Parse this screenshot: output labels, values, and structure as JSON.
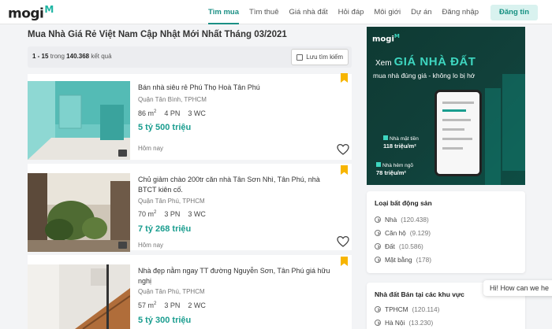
{
  "header": {
    "logo_text": "mogi",
    "logo_mark": "M",
    "nav": [
      {
        "label": "Tìm mua",
        "active": true
      },
      {
        "label": "Tìm thuê",
        "active": false
      },
      {
        "label": "Giá nhà đất",
        "active": false
      },
      {
        "label": "Hỏi đáp",
        "active": false
      },
      {
        "label": "Môi giới",
        "active": false
      },
      {
        "label": "Dự án",
        "active": false
      },
      {
        "label": "Đăng nhập",
        "active": false
      }
    ],
    "signup_label": "Đăng tin"
  },
  "main": {
    "title": "Mua Nhà Giá Rẻ Việt Nam Cập Nhật Mới Nhất Tháng 03/2021",
    "results": {
      "range": "1 - 15",
      "in_word": "trong",
      "total": "140.368",
      "suffix": "kết quả"
    },
    "save_search_label": "Lưu tìm kiếm",
    "listings": [
      {
        "title": "Bán nhà siêu rẻ Phú Thọ Hoà Tân Phú",
        "location": "Quận Tân Bình, TPHCM",
        "area": "86 m",
        "area_unit": "2",
        "bedrooms": "4 PN",
        "baths": "3 WC",
        "price": "5 tỷ 500 triệu",
        "date": "Hôm nay"
      },
      {
        "title": "Chủ giảm chào 200tr căn nhà Tân Sơn Nhì, Tân Phú, nhà BTCT kiên cố.",
        "location": "Quận Tân Phú, TPHCM",
        "area": "70 m",
        "area_unit": "2",
        "bedrooms": "3 PN",
        "baths": "3 WC",
        "price": "7 tỷ 268 triệu",
        "date": "Hôm nay"
      },
      {
        "title": "Nhà đẹp nằm ngay TT đường Nguyễn Sơn, Tân Phú giá hữu nghị",
        "location": "Quận Tân Phú, TPHCM",
        "area": "57 m",
        "area_unit": "2",
        "bedrooms": "3 PN",
        "baths": "2 WC",
        "price": "5 tỷ 300 triệu",
        "date": ""
      }
    ]
  },
  "banner": {
    "logo_text": "mogi",
    "logo_mark": "M",
    "line1_small": "Xem",
    "line1_big": "GIÁ NHÀ ĐẤT",
    "line2": "mua nhà đúng giá - không lo bị hớ",
    "tag1_label": "Nhà mặt tiền",
    "tag1_price": "118 triệu/m²",
    "tag2_label": "Nhà hẻm ngõ",
    "tag2_price": "78 triệu/m²"
  },
  "property_types": {
    "title": "Loại bất động sản",
    "items": [
      {
        "label": "Nhà",
        "count": "(120.438)"
      },
      {
        "label": "Căn hộ",
        "count": "(9.129)"
      },
      {
        "label": "Đất",
        "count": "(10.586)"
      },
      {
        "label": "Mặt bằng",
        "count": "(178)"
      }
    ]
  },
  "regions": {
    "title": "Nhà đất Bán tại các khu vực",
    "items": [
      {
        "label": "TPHCM",
        "count": "(120.114)"
      },
      {
        "label": "Hà Nội",
        "count": "(13.230)"
      }
    ]
  },
  "chat_text": "Hi! How can we he",
  "colors": {
    "accent": "#1a9d8f",
    "bookmark": "#f7b500",
    "banner_bg": "#0e3a33"
  }
}
